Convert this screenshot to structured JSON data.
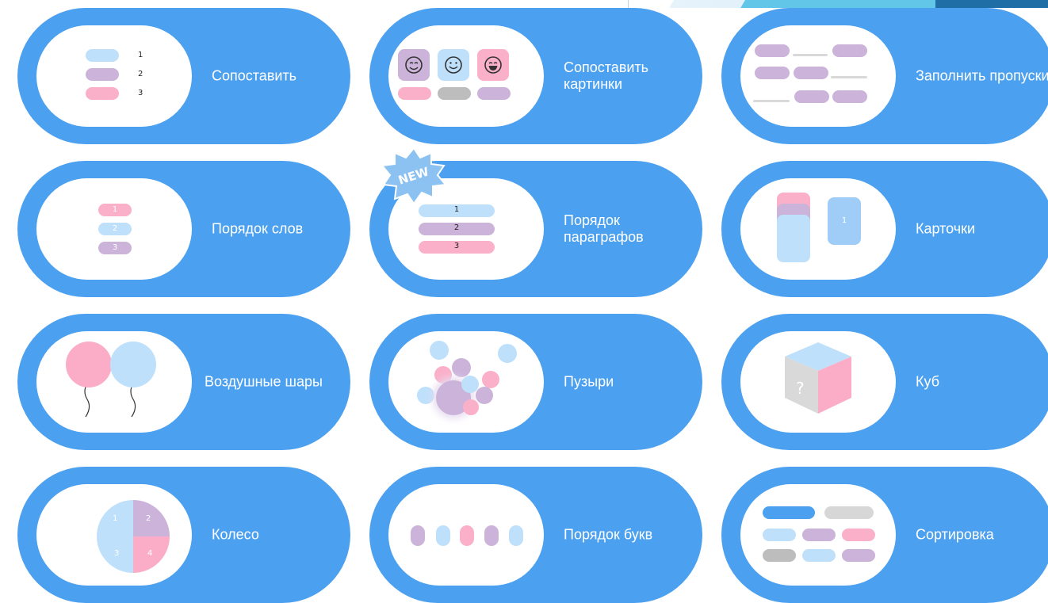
{
  "colors": {
    "card": "#4ca0f0",
    "blue": "#bfe0fb",
    "purple": "#cbb3da",
    "pink": "#fbb0c9",
    "grey": "#bdbdbd"
  },
  "cards": [
    {
      "label": "Сопоставить",
      "icon": "matching-pairs-icon"
    },
    {
      "label": "Сопоставить картинки",
      "icon": "match-pictures-icon"
    },
    {
      "label": "Заполнить пропуски",
      "icon": "fill-gaps-icon"
    },
    {
      "label": "Порядок слов",
      "icon": "word-order-icon"
    },
    {
      "label": "Порядок параграфов",
      "icon": "paragraph-order-icon",
      "badge": "NEW"
    },
    {
      "label": "Карточки",
      "icon": "flashcards-icon"
    },
    {
      "label": "Воздушные шары",
      "icon": "balloons-icon"
    },
    {
      "label": "Пузыри",
      "icon": "bubbles-icon"
    },
    {
      "label": "Куб",
      "icon": "cube-icon"
    },
    {
      "label": "Колесо",
      "icon": "wheel-icon"
    },
    {
      "label": "Порядок букв",
      "icon": "letter-order-icon"
    },
    {
      "label": "Сортировка",
      "icon": "sorting-icon"
    }
  ],
  "numbers": {
    "one": "1",
    "two": "2",
    "three": "3",
    "four": "4"
  },
  "cube_mark": "?"
}
